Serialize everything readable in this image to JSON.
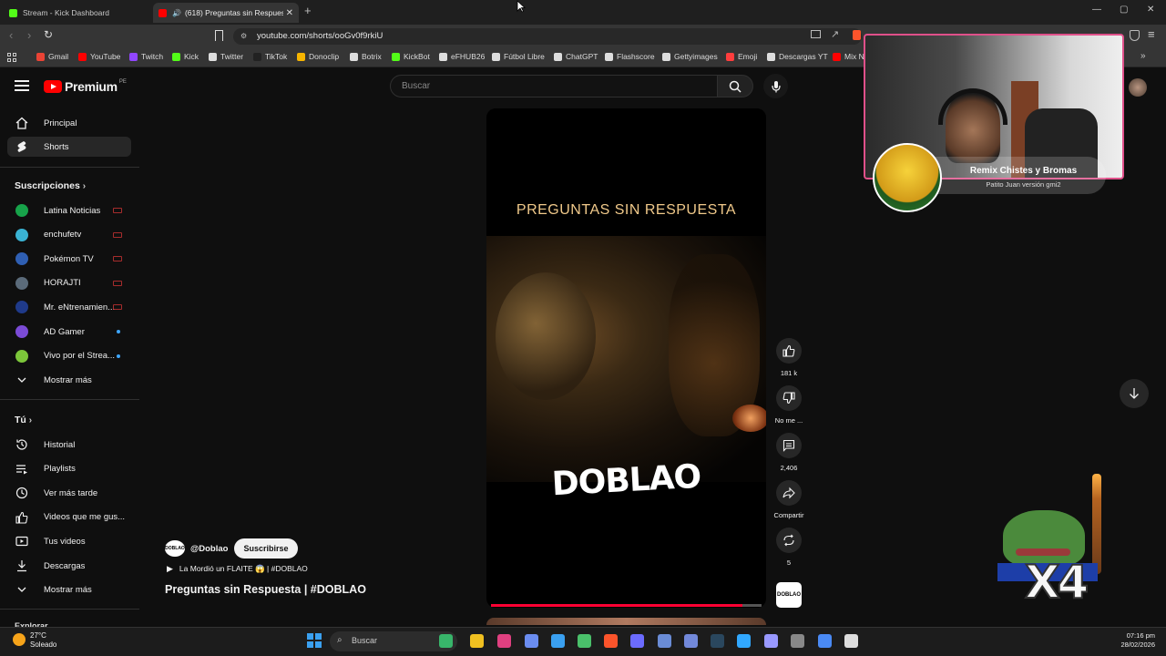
{
  "browser": {
    "tabs": [
      {
        "title": "Stream - Kick Dashboard",
        "favicon_color": "#53fc18"
      },
      {
        "title": "(618) Preguntas sin Respuesta",
        "favicon_color": "#ff0000",
        "close": "✕"
      }
    ],
    "new_tab": "+",
    "url": "youtube.com/shorts/ooGv0f9rkiU",
    "window_controls": [
      "—",
      "▢",
      "✕"
    ],
    "bookmarks": [
      {
        "label": "Gmail",
        "color": "#ea4335"
      },
      {
        "label": "YouTube",
        "color": "#ff0000"
      },
      {
        "label": "Twitch",
        "color": "#9146ff"
      },
      {
        "label": "Kick",
        "color": "#53fc18"
      },
      {
        "label": "Twitter",
        "color": "#dddddd"
      },
      {
        "label": "TikTok",
        "color": "#222222"
      },
      {
        "label": "Donoclip",
        "color": "#f7b500"
      },
      {
        "label": "Botrix",
        "color": "#dddddd"
      },
      {
        "label": "KickBot",
        "color": "#53fc18"
      },
      {
        "label": "eFHUB26",
        "color": "#dddddd"
      },
      {
        "label": "Fútbol Libre",
        "color": "#dddddd"
      },
      {
        "label": "ChatGPT",
        "color": "#dddddd"
      },
      {
        "label": "Flashscore",
        "color": "#dddddd"
      },
      {
        "label": "Gettyimages",
        "color": "#dddddd"
      },
      {
        "label": "Emoji",
        "color": "#ff3d3d"
      },
      {
        "label": "Descargas YT",
        "color": "#dddddd"
      },
      {
        "label": "Mix N",
        "color": "#ff0000"
      }
    ],
    "more": "»"
  },
  "youtube": {
    "logo_word": "Premium",
    "logo_cc": "PE",
    "search_placeholder": "Buscar",
    "sidebar": {
      "main": [
        {
          "label": "Principal",
          "icon": "home-icon"
        },
        {
          "label": "Shorts",
          "icon": "shorts-icon",
          "active": true
        }
      ],
      "subscriptions_header": "Suscripciones",
      "subscriptions": [
        {
          "label": "Latina Noticias",
          "color": "#17a34a",
          "status": "live"
        },
        {
          "label": "enchufetv",
          "color": "#3ab3d4",
          "status": "live"
        },
        {
          "label": "Pokémon TV",
          "color": "#2f5fb3",
          "status": "live"
        },
        {
          "label": "HORAJTI",
          "color": "#5b6b7a",
          "status": "live"
        },
        {
          "label": "Mr. eNtrenamien...",
          "color": "#1f3a8a",
          "status": "live"
        },
        {
          "label": "AD Gamer",
          "color": "#7b4bd6",
          "status": "new"
        },
        {
          "label": "Vivo por el Strea...",
          "color": "#7cc63a",
          "status": "new"
        }
      ],
      "show_more_1": "Mostrar más",
      "you_header": "Tú",
      "you": [
        {
          "label": "Historial",
          "icon": "history-icon"
        },
        {
          "label": "Playlists",
          "icon": "playlists-icon"
        },
        {
          "label": "Ver más tarde",
          "icon": "clock-icon"
        },
        {
          "label": "Videos que me gus...",
          "icon": "thumbs-up-icon"
        },
        {
          "label": "Tus videos",
          "icon": "video-icon"
        },
        {
          "label": "Descargas",
          "icon": "download-icon"
        }
      ],
      "show_more_2": "Mostrar más",
      "explore_header": "Explorar"
    },
    "short": {
      "overlay_title": "PREGUNTAS SIN RESPUESTA",
      "overlay_brand": "DOBLAO",
      "progress": 0.93,
      "channel_handle": "@Doblao",
      "channel_avatar_text": "DOBLAO",
      "subscribe_label": "Suscribirse",
      "sound": "La Mordió un FLAITE 😱 | #DOBLAO",
      "caption": "Preguntas sin Respuesta | #DOBLAO",
      "actions": {
        "likes": "181 k",
        "dislike": "No me ...",
        "comments": "2,406",
        "share": "Compartir",
        "remix": "5"
      }
    }
  },
  "stream_overlay": {
    "alert_title": "Remix Chistes y Bromas",
    "alert_subtitle": "Patito Juan versión gmi2",
    "multiplier": "X4"
  },
  "taskbar": {
    "temperature": "27°C",
    "weather": "Soleado",
    "search_label": "Buscar",
    "time": "07:16 pm",
    "date": "28/02/2026",
    "app_colors": [
      "#38b56a",
      "#f0c020",
      "#e04080",
      "#6b8df0",
      "#3aa0f0",
      "#4ac06a",
      "#fb542b",
      "#6b6bff",
      "#6a8cd6",
      "#7289da",
      "#2a475e",
      "#31a8ff",
      "#9999ff",
      "#888888",
      "#4a8af4",
      "#dddddd",
      "#1e9be0"
    ]
  }
}
